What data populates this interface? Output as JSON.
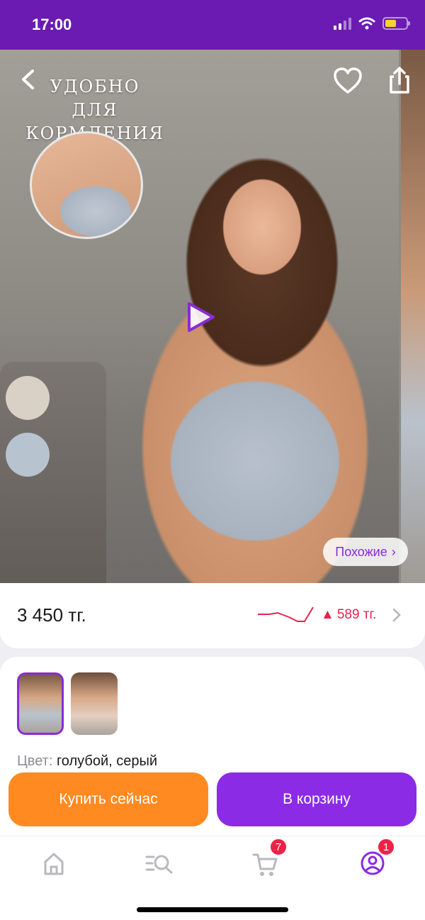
{
  "status_bar": {
    "time": "17:00",
    "battery_color": "#f5d22d"
  },
  "gallery": {
    "promo_text": "УДОБНО ДЛЯ КОРМЛЕНИЯ",
    "similar_label": "Похожие",
    "swatches": [
      "beige",
      "light-blue"
    ]
  },
  "price": {
    "current": "3 450 тг.",
    "change": "589 тг.",
    "change_color": "#e8224d"
  },
  "variants": {
    "color_label": "Цвет:",
    "color_value": "голубой, серый"
  },
  "actions": {
    "buy_now": "Купить сейчас",
    "add_to_cart": "В корзину",
    "buy_color": "#ff8a21",
    "cart_color": "#8b2be6"
  },
  "tab_bar": {
    "cart_badge": "7",
    "profile_badge": "1",
    "accent": "#8b2be6"
  },
  "colors": {
    "brand": "#6b1bb1"
  }
}
